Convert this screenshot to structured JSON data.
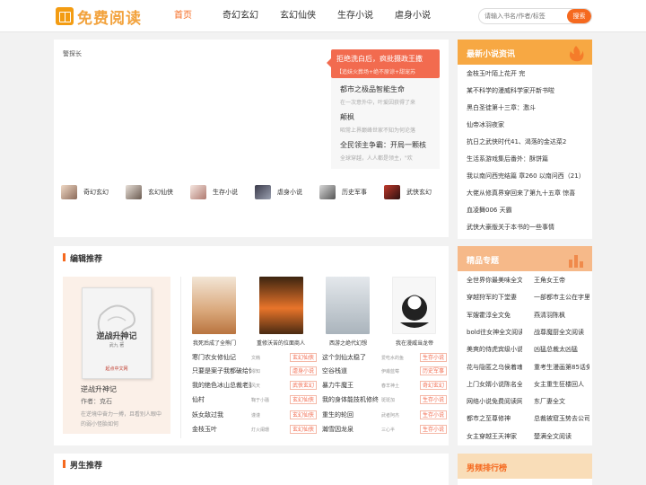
{
  "header": {
    "logo_text": "免费阅读",
    "nav": [
      "首页",
      "奇幻玄幻",
      "玄幻仙侠",
      "生存小说",
      "虐身小说"
    ],
    "search_placeholder": "请输入书名/作者/标签",
    "search_button": "搜索"
  },
  "banner": {
    "image_alt": "警探长",
    "ad": {
      "title": "拒绝洗白后，疯批摄政王撒",
      "sub": "【追妹火葬场+绝不原谅+甜宠苏"
    },
    "list": [
      {
        "title": "都市之极品智能生命",
        "sub": "在一次意外中，叶爱因获得了来"
      },
      {
        "title": "颠枫",
        "sub": "昭常上界巅峰世家不知为何沦落"
      },
      {
        "title": "全民领主争霸：开局一颗核",
        "sub": "全球穿越，人人都是领主，\"欢"
      }
    ],
    "categories": [
      "奇幻玄幻",
      "玄幻仙侠",
      "生存小说",
      "虐身小说",
      "历史军事",
      "武侠玄幻"
    ]
  },
  "editor": {
    "title": "编辑推荐",
    "feature": {
      "cover_title": "逆战升神记",
      "cover_sub": "武九 著",
      "cover_mark": "起点中文网",
      "name": "逆战升神记",
      "author": "作者：克石",
      "desc": "在逆境中奋力一搏，且看别人眼中的弱小怪胎如何"
    },
    "covers": [
      {
        "caption": "我死后成了全熊门",
        "color": "#e8c9a0"
      },
      {
        "caption": "重修沃苦的位面商人",
        "color": "#e07a2e"
      },
      {
        "caption": "西游之绝代幻想",
        "color": "#c9cfd4"
      },
      {
        "caption": "我在漫威当龙帝",
        "color": "#f4f4f4"
      }
    ],
    "books": [
      {
        "name": "寒门农女修仙记",
        "author": "文韩",
        "tag": "玄幻仙侠"
      },
      {
        "name": "只要是案子我都破给你看",
        "author": "缪知",
        "tag": "虐身小说"
      },
      {
        "name": "我的绝色冰山总裁老婆",
        "author": "风天",
        "tag": "武侠玄幻"
      },
      {
        "name": "仙村",
        "author": "鞠于小骚",
        "tag": "玄幻仙侠"
      },
      {
        "name": "妖女敌过我",
        "author": "谨谨",
        "tag": "玄幻仙侠"
      },
      {
        "name": "金枝玉叶",
        "author": "灯火阑珊",
        "tag": "玄幻仙侠"
      }
    ],
    "books2": [
      {
        "name": "这个剑仙太稳了",
        "author": "爱吃水的鱼",
        "tag": "生存小说"
      },
      {
        "name": "空谷栈道",
        "author": "伊甫蓝莓",
        "tag": "历史军事"
      },
      {
        "name": "暴力牛魔王",
        "author": "春羊神土",
        "tag": "奇幻玄幻"
      },
      {
        "name": "我的身体能技机修终",
        "author": "斑斑加",
        "tag": "生存小说"
      },
      {
        "name": "重生的轮回",
        "author": "武者阿杰",
        "tag": "生存小说"
      },
      {
        "name": "瀚雪因龙泉",
        "author": "三心半",
        "tag": "生存小说"
      }
    ]
  },
  "male": {
    "title": "男生推荐"
  },
  "news": {
    "title": "最新小说资讯",
    "items": [
      "金枝玉叶陌上花开 完",
      "某不科学的漫威科学家开新书啦",
      "黑白圣徒第十三章：激斗",
      "仙帝冰羽夜家",
      "抗日之武侠时代41、渴落的金达菜2",
      "生活系游戏集后番外：酥饼篇",
      "我以南问西完结篇 章260 以南问西（21）",
      "大佬从修真界穿回来了第九十五章 惊喜",
      "血凌舞006 天霸",
      "武侠大豪版关于本书的一些事情"
    ]
  },
  "topics": {
    "title": "精品专题",
    "items": [
      "全世界你最美味全文阅读",
      "王角女王帝",
      "穿越狩军的下堂妻",
      "一部都市主公在字里行间",
      "军嫂霍淳全文免",
      "燕清羽陈枫",
      "bold往女神全文阅读",
      "战尊魔厨全文阅读",
      "美爽的侍虎宾级小说",
      "凶猛总裁太凶猛",
      "花与隐匿之乌侯着魂",
      "重考生漫画第85话免费",
      "上门女婿小说陈名全文",
      "女主重生狂楼回人",
      "网络小说免费阅读网",
      "东厂妻全文",
      "都市之至尊修神",
      "总裁被窟玉势去公司",
      "女主穿越王天神家",
      "楚满全文阅读"
    ]
  },
  "rank": {
    "title": "男频排行榜"
  },
  "colors": {
    "accent": "#f5691f",
    "news_header": "#f7a843",
    "topic_header": "#f6b989",
    "rank_header": "#f9ddb8"
  }
}
